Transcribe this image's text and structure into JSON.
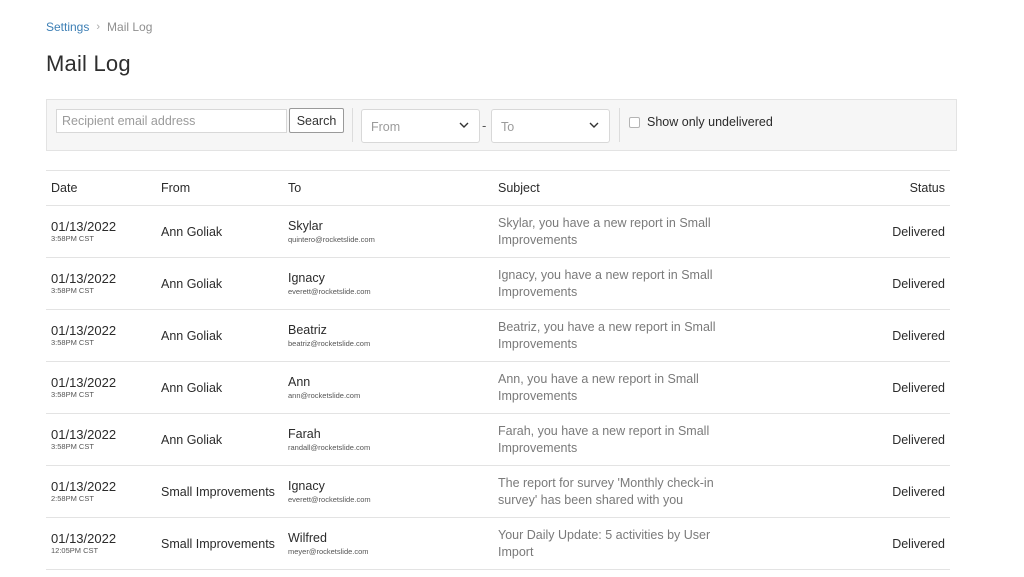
{
  "breadcrumb": {
    "parent": "Settings",
    "current": "Mail Log"
  },
  "page": {
    "title": "Mail Log"
  },
  "filters": {
    "search_placeholder": "Recipient email address",
    "search_value": "",
    "search_button": "Search",
    "from_label": "From",
    "to_label": "To",
    "range_separator": "-",
    "undelivered_label": "Show only undelivered",
    "undelivered_checked": false
  },
  "table": {
    "columns": {
      "date": "Date",
      "from": "From",
      "to": "To",
      "subject": "Subject",
      "status": "Status"
    },
    "rows": [
      {
        "date": "01/13/2022",
        "time": "3:58PM CST",
        "from": "Ann Goliak",
        "to_name": "Skylar",
        "to_email": "quintero@rocketslide.com",
        "subject": "Skylar, you have a new report in Small Improvements",
        "status": "Delivered"
      },
      {
        "date": "01/13/2022",
        "time": "3:58PM CST",
        "from": "Ann Goliak",
        "to_name": "Ignacy",
        "to_email": "everett@rocketslide.com",
        "subject": "Ignacy, you have a new report in Small Improvements",
        "status": "Delivered"
      },
      {
        "date": "01/13/2022",
        "time": "3:58PM CST",
        "from": "Ann Goliak",
        "to_name": "Beatriz",
        "to_email": "beatriz@rocketslide.com",
        "subject": "Beatriz, you have a new report in Small Improvements",
        "status": "Delivered"
      },
      {
        "date": "01/13/2022",
        "time": "3:58PM CST",
        "from": "Ann Goliak",
        "to_name": "Ann",
        "to_email": "ann@rocketslide.com",
        "subject": "Ann, you have a new report in Small Improvements",
        "status": "Delivered"
      },
      {
        "date": "01/13/2022",
        "time": "3:58PM CST",
        "from": "Ann Goliak",
        "to_name": "Farah",
        "to_email": "randall@rocketslide.com",
        "subject": "Farah, you have a new report in Small Improvements",
        "status": "Delivered"
      },
      {
        "date": "01/13/2022",
        "time": "2:58PM CST",
        "from": "Small Improvements",
        "to_name": "Ignacy",
        "to_email": "everett@rocketslide.com",
        "subject": "The report for survey 'Monthly check-in survey' has been shared with you",
        "status": "Delivered"
      },
      {
        "date": "01/13/2022",
        "time": "12:05PM CST",
        "from": "Small Improvements",
        "to_name": "Wilfred",
        "to_email": "meyer@rocketslide.com",
        "subject": "Your Daily Update: 5 activities by User Import",
        "status": "Delivered"
      }
    ]
  },
  "icons": {
    "breadcrumb_separator": "chevron-right-icon",
    "select_arrow": "chevron-down-icon"
  },
  "colors": {
    "link": "#3d7fb5",
    "muted_text": "#7a7a7a",
    "filter_background": "#f6f6f6",
    "border": "#e3e3e3"
  }
}
